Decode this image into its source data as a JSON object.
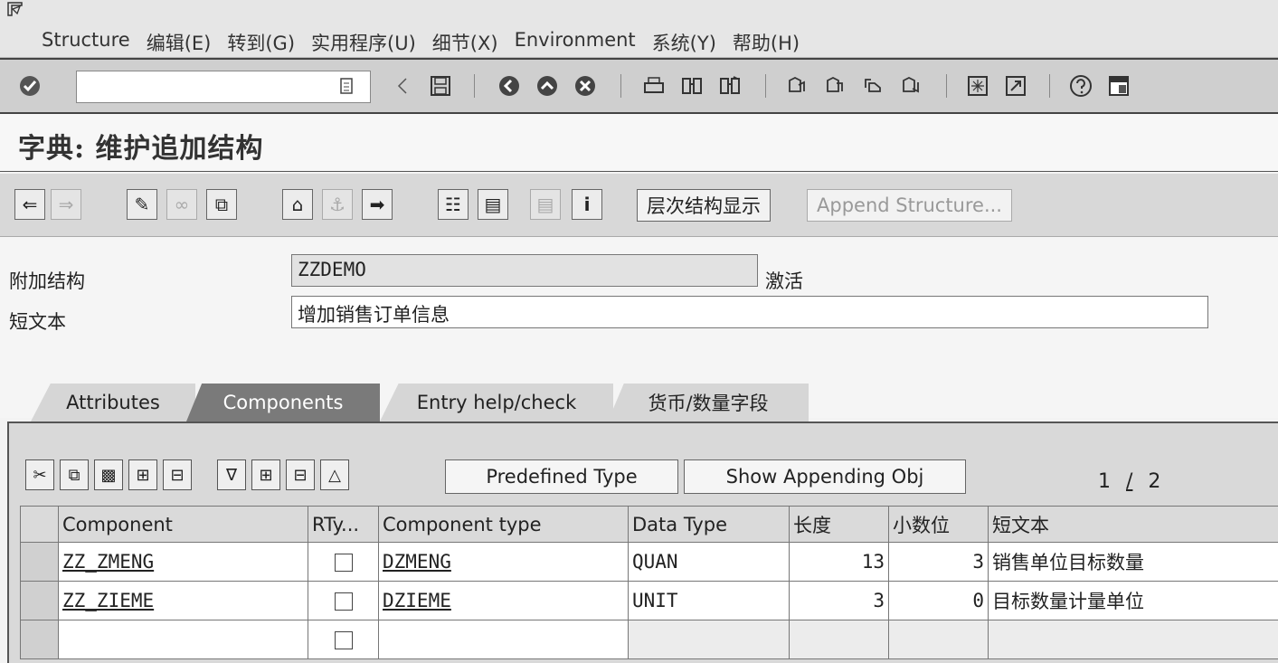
{
  "menu": [
    "Structure",
    "编辑(E)",
    "转到(G)",
    "实用程序(U)",
    "细节(X)",
    "Environment",
    "系统(Y)",
    "帮助(H)"
  ],
  "command_field": {
    "value": ""
  },
  "page_title": "字典: 维护追加结构",
  "app_toolbar": {
    "hierarchy_button": "层次结构显示",
    "append_structure_button": "Append Structure..."
  },
  "fields": {
    "append_structure": {
      "label": "附加结构",
      "value": "ZZDEMO",
      "status": "激活"
    },
    "short_text": {
      "label": "短文本",
      "value": "增加销售订单信息"
    }
  },
  "tabs": [
    {
      "label": "Attributes",
      "active": false
    },
    {
      "label": "Components",
      "active": true
    },
    {
      "label": "Entry help/check",
      "active": false
    },
    {
      "label": "货币/数量字段",
      "active": false
    }
  ],
  "table_toolbar": {
    "predefined_type_button": "Predefined Type",
    "show_appending_obj_button": "Show Appending Obj",
    "pager_current": "1",
    "pager_sep": "/",
    "pager_total": "2"
  },
  "grid": {
    "columns": [
      "Component",
      "RTy...",
      "Component type",
      "Data Type",
      "长度",
      "小数位",
      "短文本"
    ],
    "rows": [
      {
        "component": "ZZ_ZMENG",
        "rty": false,
        "component_type": "DZMENG",
        "data_type": "QUAN",
        "length": "13",
        "decimals": "3",
        "short_text": "销售单位目标数量"
      },
      {
        "component": "ZZ_ZIEME",
        "rty": false,
        "component_type": "DZIEME",
        "data_type": "UNIT",
        "length": "3",
        "decimals": "0",
        "short_text": "目标数量计量单位"
      },
      {
        "component": "",
        "rty": false,
        "component_type": "",
        "data_type": "",
        "length": "",
        "decimals": "",
        "short_text": ""
      }
    ]
  }
}
